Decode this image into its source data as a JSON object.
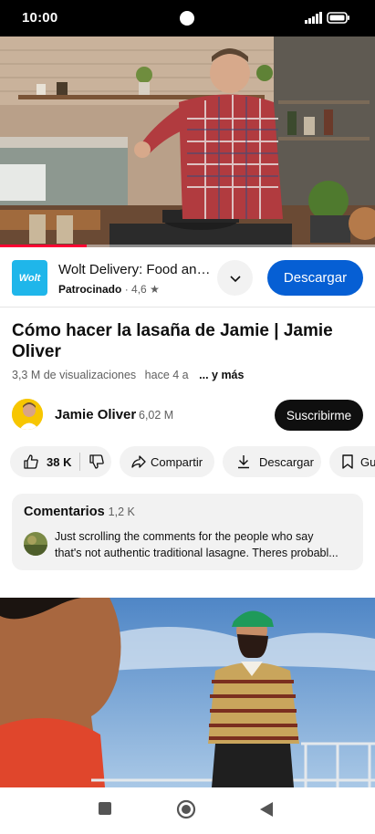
{
  "status_bar": {
    "time": "10:00"
  },
  "video": {
    "progress": 0.23
  },
  "ad": {
    "logo_text": "Wolt",
    "title": "Wolt Delivery: Food and...",
    "sponsored_label": "Patrocinado",
    "rating": "4,6",
    "cta_label": "Descargar"
  },
  "video_info": {
    "title": "Cómo hacer la lasaña de Jamie | Jamie Oliver",
    "views": "3,3 M de visualizaciones",
    "age": "hace 4 a",
    "more_label": "... y más"
  },
  "channel": {
    "name": "Jamie Oliver",
    "subscribers": "6,02 M",
    "subscribe_label": "Suscribirme"
  },
  "actions": {
    "likes": "38 K",
    "share_label": "Compartir",
    "download_label": "Descargar",
    "save_label": "Gua"
  },
  "comments": {
    "title": "Comentarios",
    "count": "1,2 K",
    "top_comment_line1": "Just scrolling the comments for the people who say",
    "top_comment_line2": "that's not authentic traditional lasagne. Theres probabl..."
  },
  "colors": {
    "accent_blue": "#065fd4",
    "progress_red": "#ff0033",
    "wolt_blue": "#1fb6ea"
  }
}
